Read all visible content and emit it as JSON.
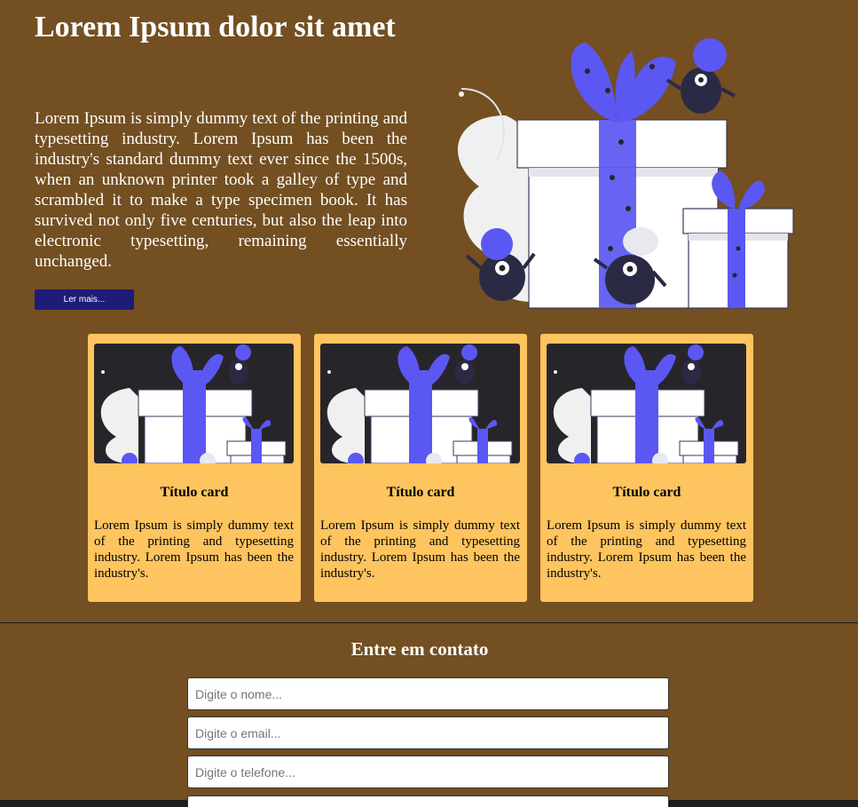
{
  "hero": {
    "title": "Lorem Ipsum dolor sit amet",
    "text": "Lorem Ipsum is simply dummy text of the printing and typesetting industry. Lorem Ipsum has been the industry's standard dummy text ever since the 1500s, when an unknown printer took a galley of type and scrambled it to make a type specimen book. It has survived not only five centuries, but also the leap into electronic typesetting, remaining essentially unchanged.",
    "button_label": "Ler mais..."
  },
  "cards": [
    {
      "title": "Título card",
      "text": "Lorem Ipsum is simply dummy text of the printing and typesetting industry. Lorem Ipsum has been the industry's."
    },
    {
      "title": "Título card",
      "text": "Lorem Ipsum is simply dummy text of the printing and typesetting industry. Lorem Ipsum has been the industry's."
    },
    {
      "title": "Título card",
      "text": "Lorem Ipsum is simply dummy text of the printing and typesetting industry. Lorem Ipsum has been the industry's."
    }
  ],
  "contact": {
    "title": "Entre em contato",
    "name_placeholder": "Digite o nome...",
    "email_placeholder": "Digite o email...",
    "phone_placeholder": "Digite o telefone..."
  },
  "colors": {
    "background": "#734f22",
    "card": "#fec45f",
    "button": "#1e1c78",
    "accent": "#5b57f2"
  },
  "icons": {
    "hero_image": "gift-boxes-monsters-illustration",
    "card_image": "gift-boxes-illustration-dark"
  }
}
